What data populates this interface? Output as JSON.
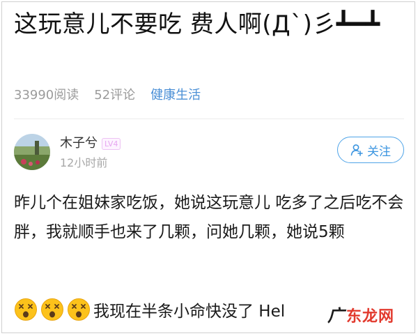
{
  "post": {
    "title": "这玩意儿不要吃 费人啊(Д`)彡┻━┻",
    "reads": "33990阅读",
    "comments": "52评论",
    "topic": "健康生活"
  },
  "author": {
    "name": "木子兮",
    "level": "LV4",
    "time": "12小时前",
    "follow_label": "关注"
  },
  "content": {
    "paragraph": "昨儿个在姐妹家吃饭，她说这玩意儿 吃多了之后吃不会胖，我就顺手也来了几颗，问她几颗，她说5颗",
    "last_line": "我现在半条小命快没了 Hel"
  },
  "watermark": {
    "text": "东龙网"
  },
  "colors": {
    "accent": "#4fa4e8",
    "topic": "#4a8fd6",
    "watermark": "#e23a2e"
  }
}
